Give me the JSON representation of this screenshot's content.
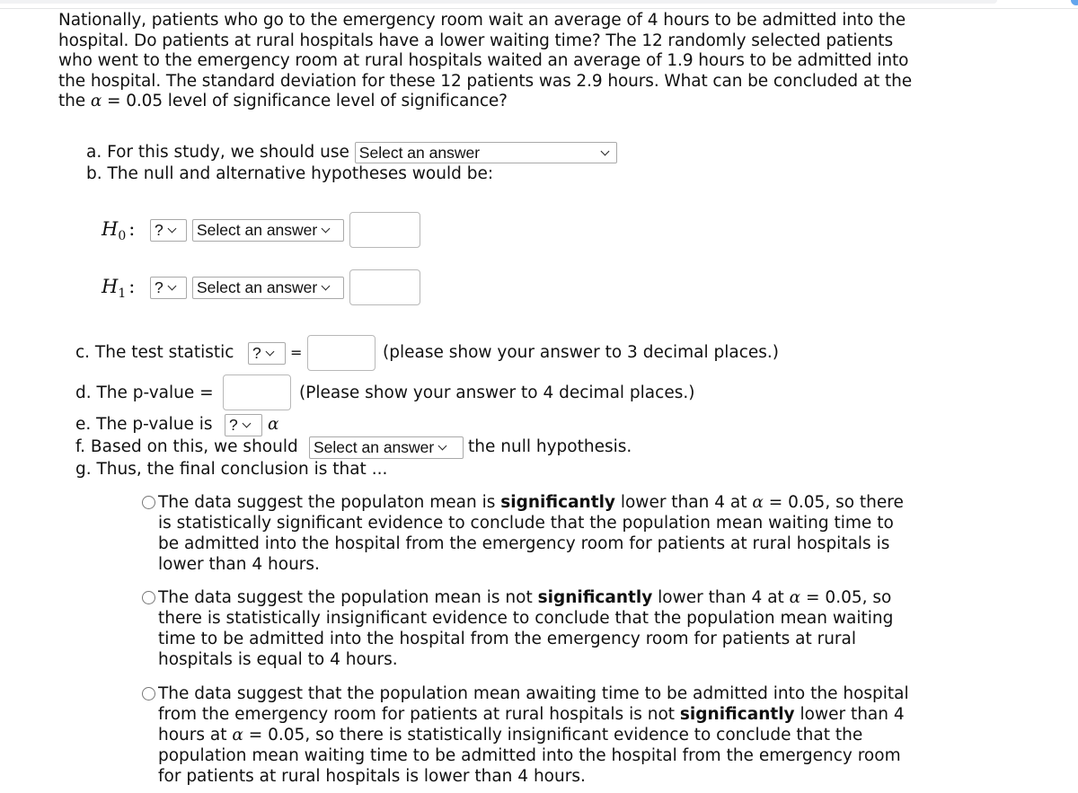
{
  "question": {
    "text_before_alpha": "Nationally, patients who go to the emergency room wait an average of 4 hours to be admitted into the hospital. Do patients at rural hospitals have a lower waiting time? The 12 randomly selected patients who went to the emergency room at rural hospitals waited an average of 1.9 hours to be admitted into the hospital. The standard deviation for these 12 patients was 2.9 hours. What can be concluded at the the",
    "alpha_symbol": "α",
    "text_after_alpha": "= 0.05 level of significance level of significance?"
  },
  "part_a": {
    "label": "a. For this study, we should use",
    "select_value": "Select an answer"
  },
  "part_b": {
    "label": "b. The null and alternative hypotheses would be:",
    "h0": {
      "symbol": "H",
      "sub": "0",
      "colon": ":",
      "param_select": "?",
      "op_select": "Select an answer",
      "value": ""
    },
    "h1": {
      "symbol": "H",
      "sub": "1",
      "colon": ":",
      "param_select": "?",
      "op_select": "Select an answer",
      "value": ""
    }
  },
  "part_c": {
    "label": "c. The test statistic",
    "select_value": "?",
    "equals": "=",
    "value": "",
    "note": "(please show your answer to 3 decimal places.)"
  },
  "part_d": {
    "label": "d. The p-value =",
    "value": "",
    "note": "(Please show your answer to 4 decimal places.)"
  },
  "part_e": {
    "label": "e. The p-value is",
    "select_value": "?",
    "alpha_symbol": "α"
  },
  "part_f": {
    "label": "f. Based on this, we should",
    "select_value": "Select an answer",
    "suffix": "the null hypothesis."
  },
  "part_g": {
    "label": "g. Thus, the final conclusion is that ...",
    "options": [
      {
        "t1": "The data suggest the populaton mean is ",
        "bold": "significantly",
        "t2": " lower than 4 at ",
        "alpha": "α",
        "t3": " = 0.05, so there is statistically significant evidence to conclude that the population mean waiting time to be admitted into the hospital from the emergency room for patients at rural hospitals is lower than 4 hours.",
        "selected": false
      },
      {
        "t1": "The data suggest the population mean is not ",
        "bold": "significantly",
        "t2": " lower than 4 at ",
        "alpha": "α",
        "t3": " = 0.05, so there is statistically insignificant evidence to conclude that the population mean waiting time to be admitted into the hospital from the emergency room for patients at rural hospitals is equal to 4 hours.",
        "selected": false
      },
      {
        "t1": "The data suggest that the population mean awaiting time to be admitted into the hospital from the emergency room for patients at rural hospitals is not ",
        "bold": "significantly",
        "t2": " lower than 4 hours at ",
        "alpha": "α",
        "t3": " = 0.05, so there is statistically insignificant evidence to conclude that the population mean waiting time to be admitted into the hospital from the emergency room for patients at rural hospitals is lower than 4 hours.",
        "selected": false
      }
    ]
  }
}
